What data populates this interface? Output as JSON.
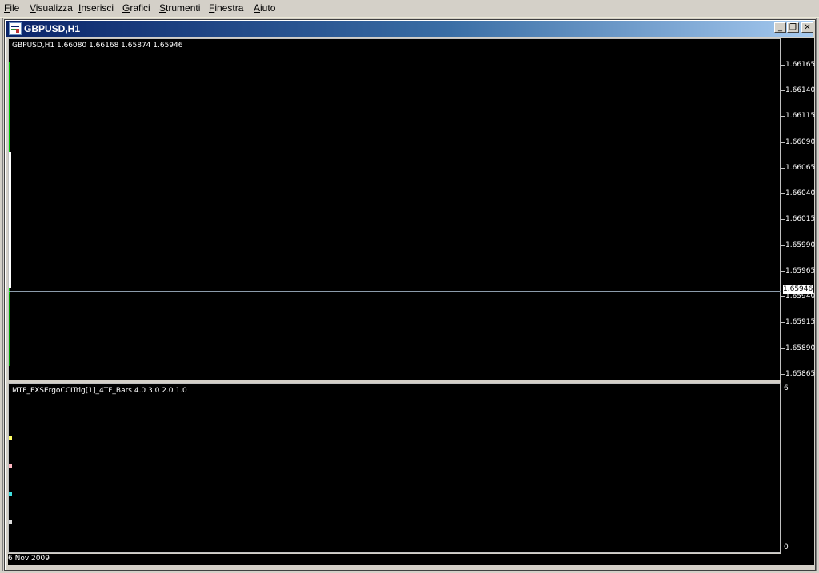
{
  "menu": {
    "items": [
      {
        "id": "file",
        "accel": "F",
        "rest": "ile"
      },
      {
        "id": "visualizza",
        "accel": "V",
        "rest": "isualizza"
      },
      {
        "id": "inserisci",
        "accel": "I",
        "rest": "nserisci"
      },
      {
        "id": "grafici",
        "accel": "G",
        "rest": "rafici"
      },
      {
        "id": "strumenti",
        "accel": "S",
        "rest": "trumenti"
      },
      {
        "id": "finestra",
        "accel": "F",
        "rest": "inestra"
      },
      {
        "id": "aiuto",
        "accel": "A",
        "rest": "iuto"
      }
    ]
  },
  "window": {
    "title": "GBPUSD,H1",
    "buttons": {
      "minimize": "_",
      "restore": "❐",
      "close": "✕"
    }
  },
  "chart": {
    "main_label": "GBPUSD,H1  1.66080 1.66168 1.65874 1.65946",
    "indicator_label": "MTF_FXSErgoCCITrig[1]_4TF_Bars 4.0 3.0 2.0 1.0",
    "current_price": "1.65946",
    "price_ticks": [
      "1.66165",
      "1.66140",
      "1.66115",
      "1.66090",
      "1.66065",
      "1.66040",
      "1.66015",
      "1.65990",
      "1.65965",
      "1.65940",
      "1.65915",
      "1.65890",
      "1.65865"
    ],
    "indicator_ticks": {
      "top": "6",
      "bottom": "0"
    },
    "time_label": "6 Nov 2009"
  },
  "colors": {
    "background": "#000000",
    "bull": "#00c800",
    "bid_line": "#8c9cac",
    "tf1": "#ffff66",
    "tf2": "#ffb6c1",
    "tf3": "#40e0e0",
    "tf4": "#dcdcdc"
  }
}
